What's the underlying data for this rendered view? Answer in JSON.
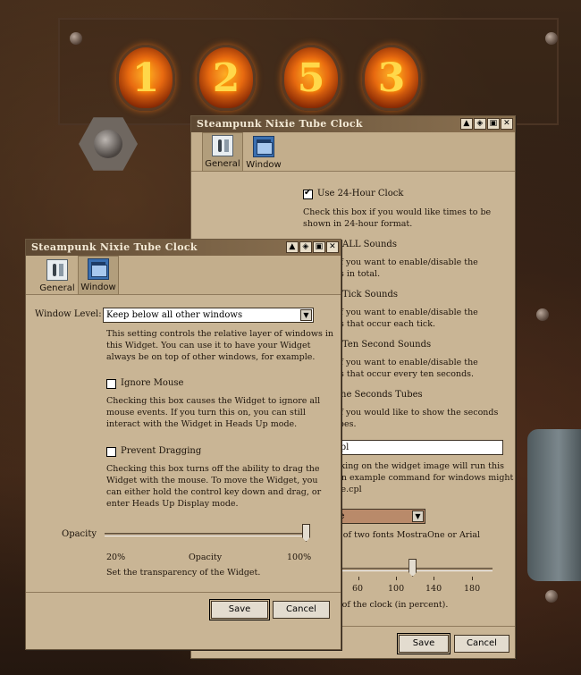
{
  "nixie_digits": [
    "1",
    "2",
    "5",
    "3"
  ],
  "back_window": {
    "title": "Steampunk Nixie Tube Clock",
    "title_buttons": [
      "▲",
      "◈",
      "▣",
      "✕"
    ],
    "tabs": [
      {
        "label": "General",
        "icon": "sliders-icon",
        "active": true
      },
      {
        "label": "Window",
        "icon": "window-icon",
        "active": false
      }
    ],
    "use24": {
      "label": "Use 24-Hour Clock",
      "checked": true,
      "hint": "Check this box if you would like times to be shown in 24-hour format."
    },
    "all_sounds": {
      "label": "ALL Sounds",
      "hint1": "x if you want to enable/disable the",
      "hint2": "ces in total."
    },
    "tick_sounds": {
      "label": "Tick Sounds",
      "hint1": "x if you want to enable/disable the",
      "hint2": "ces that occur each tick."
    },
    "ten_sounds": {
      "label": "Ten Second Sounds",
      "hint1": "x if you want to enable/disable the",
      "hint2": "ces that occur every ten seconds."
    },
    "seconds_tubes": {
      "label": "the Seconds Tubes",
      "hint1": "x if you would like to show the seconds",
      "hint2": "tubes."
    },
    "command_value": ".cpl",
    "command_hint1": "licking on the widget image will run this",
    "command_hint2": ". An example command for windows might",
    "command_hint3": "late.cpl",
    "font_value": "ne",
    "font_hint": "ne of two fonts MostraOne or Arial",
    "scale_ticks": [
      "60",
      "100",
      "140",
      "180"
    ],
    "scale_value": 100,
    "scale_hint": "ze of the clock (in percent).",
    "save_label": "Save",
    "cancel_label": "Cancel"
  },
  "front_window": {
    "title": "Steampunk Nixie Tube Clock",
    "title_buttons": [
      "▲",
      "◈",
      "▣",
      "✕"
    ],
    "tabs": [
      {
        "label": "General",
        "icon": "sliders-icon",
        "active": false
      },
      {
        "label": "Window",
        "icon": "window-icon",
        "active": true
      }
    ],
    "window_level": {
      "label": "Window Level:",
      "value": "Keep below all other windows",
      "hint1": "This setting controls the relative layer of windows in",
      "hint2": "this Widget. You can use it to have your Widget",
      "hint3": "always be on top of other windows, for example."
    },
    "ignore_mouse": {
      "label": "Ignore Mouse",
      "checked": false,
      "hint1": "Checking this box causes the Widget to ignore all",
      "hint2": "mouse events. If you turn this on, you can still",
      "hint3": "interact with the Widget in Heads Up mode."
    },
    "prevent_dragging": {
      "label": "Prevent Dragging",
      "checked": false,
      "hint1": "Checking this box turns off the ability to drag the",
      "hint2": "Widget with the mouse. To move the Widget, you",
      "hint3": "can either hold the control key down and drag, or",
      "hint4": "enter Heads Up Display mode."
    },
    "opacity": {
      "label": "Opacity",
      "min_label": "20%",
      "mid_label": "Opacity",
      "max_label": "100%",
      "value_percent": 100,
      "hint": "Set the transparency of the Widget."
    },
    "save_label": "Save",
    "cancel_label": "Cancel"
  }
}
